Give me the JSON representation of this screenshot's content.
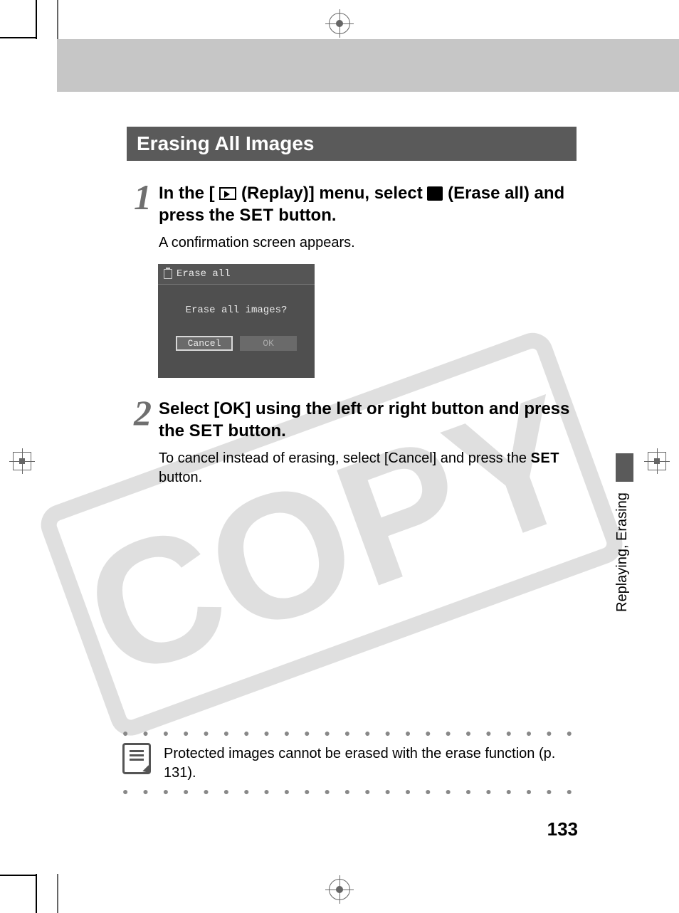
{
  "section_title": "Erasing All Images",
  "step1": {
    "num": "1",
    "head_a": "In the [",
    "head_b": "(Replay)] menu, select",
    "head_c": "(Erase all) and press the",
    "head_set": "SET",
    "head_d": "button.",
    "text": "A confirmation screen appears."
  },
  "lcd": {
    "title": "Erase all",
    "prompt": "Erase all images?",
    "cancel": "Cancel",
    "ok": "OK"
  },
  "step2": {
    "num": "2",
    "head_a": "Select [OK] using the left or right button and press the",
    "head_set": "SET",
    "head_b": "button.",
    "text_a": "To cancel instead of erasing, select [Cancel] and press the",
    "text_set": "SET",
    "text_b": "button."
  },
  "side_label": "Replaying, Erasing",
  "note": "Protected images cannot be erased with the erase function (p. 131).",
  "page_number": "133",
  "watermark_text": "COPY"
}
